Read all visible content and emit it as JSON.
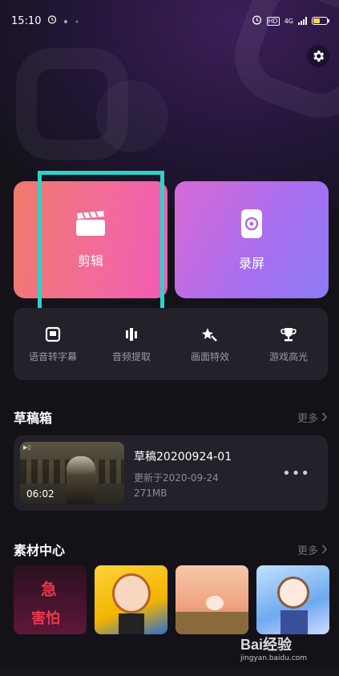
{
  "status_bar": {
    "time": "15:10",
    "network": "4G",
    "hd": "HD"
  },
  "icons": {
    "settings": "gear-icon",
    "edit": "clapperboard-icon",
    "record": "record-screen-icon"
  },
  "main_cards": {
    "edit_label": "剪辑",
    "record_label": "录屏"
  },
  "tools": [
    {
      "label": "语音转字幕",
      "icon": "subtitle-icon"
    },
    {
      "label": "音频提取",
      "icon": "audio-extract-icon"
    },
    {
      "label": "画面特效",
      "icon": "effects-icon"
    },
    {
      "label": "游戏高光",
      "icon": "trophy-icon"
    }
  ],
  "drafts": {
    "title": "草稿箱",
    "more": "更多",
    "item": {
      "name": "草稿20200924-01",
      "updated": "更新于2020-09-24",
      "size": "271MB",
      "duration": "06:02"
    }
  },
  "assets": {
    "title": "素材中心",
    "more": "更多",
    "tile1_text_top": "急",
    "tile1_text_bottom": "害怕"
  },
  "watermark": {
    "top": "Bai经验",
    "bottom": "jingyan.baidu.com"
  },
  "colors": {
    "highlight": "#2bd3c8",
    "edit_card": "#f26a9d",
    "record_card": "#a56ff0"
  }
}
